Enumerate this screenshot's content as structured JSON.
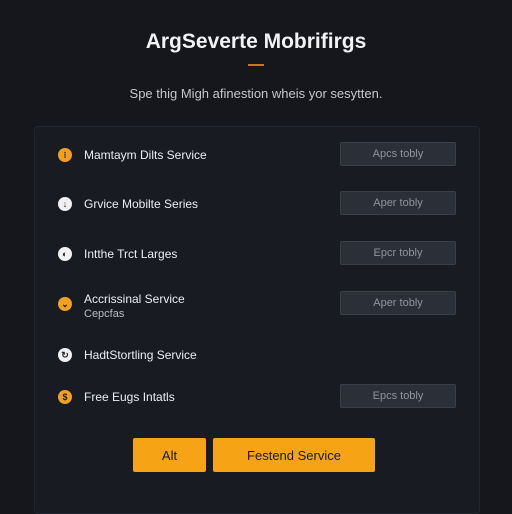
{
  "header": {
    "title": "ArgSeverte Mobrifirgs",
    "subtitle": "Spe thig Migh afinestion wheis yor sesytten."
  },
  "services": [
    {
      "label": "Mamtaym Dilts Service",
      "button": "Apcs tobly",
      "icon": "clock-icon",
      "icon_color": "#f2a01f",
      "icon_glyph": "⁝"
    },
    {
      "label": "Grvice Mobilte Series",
      "button": "Aper tobly",
      "icon": "download-icon",
      "icon_color": "#f1f1f3",
      "icon_glyph": "↓"
    },
    {
      "label": "Intthe Trct Larges",
      "button": "Epcr tobly",
      "icon": "moon-icon",
      "icon_color": "#f1f1f3",
      "icon_glyph": "◐"
    },
    {
      "label": "Accrissinal Service",
      "sublabel": "Cepcfas",
      "button": "Aper tobly",
      "icon": "chevron-down-icon",
      "icon_color": "#f2a01f",
      "icon_glyph": "⌄"
    },
    {
      "label": "HadtStortling Service",
      "icon": "refresh-icon",
      "icon_color": "#f1f1f3",
      "icon_glyph": "↻"
    },
    {
      "label": "Free Eugs Intatls",
      "button": "Epcs tobly",
      "icon": "dollar-icon",
      "icon_color": "#f2a01f",
      "icon_glyph": "$"
    }
  ],
  "actions": {
    "alt_label": "Alt",
    "primary_label": "Festend Service"
  },
  "colors": {
    "accent": "#f6a316",
    "background": "#15171d",
    "button_disabled": "#2b2f38"
  }
}
